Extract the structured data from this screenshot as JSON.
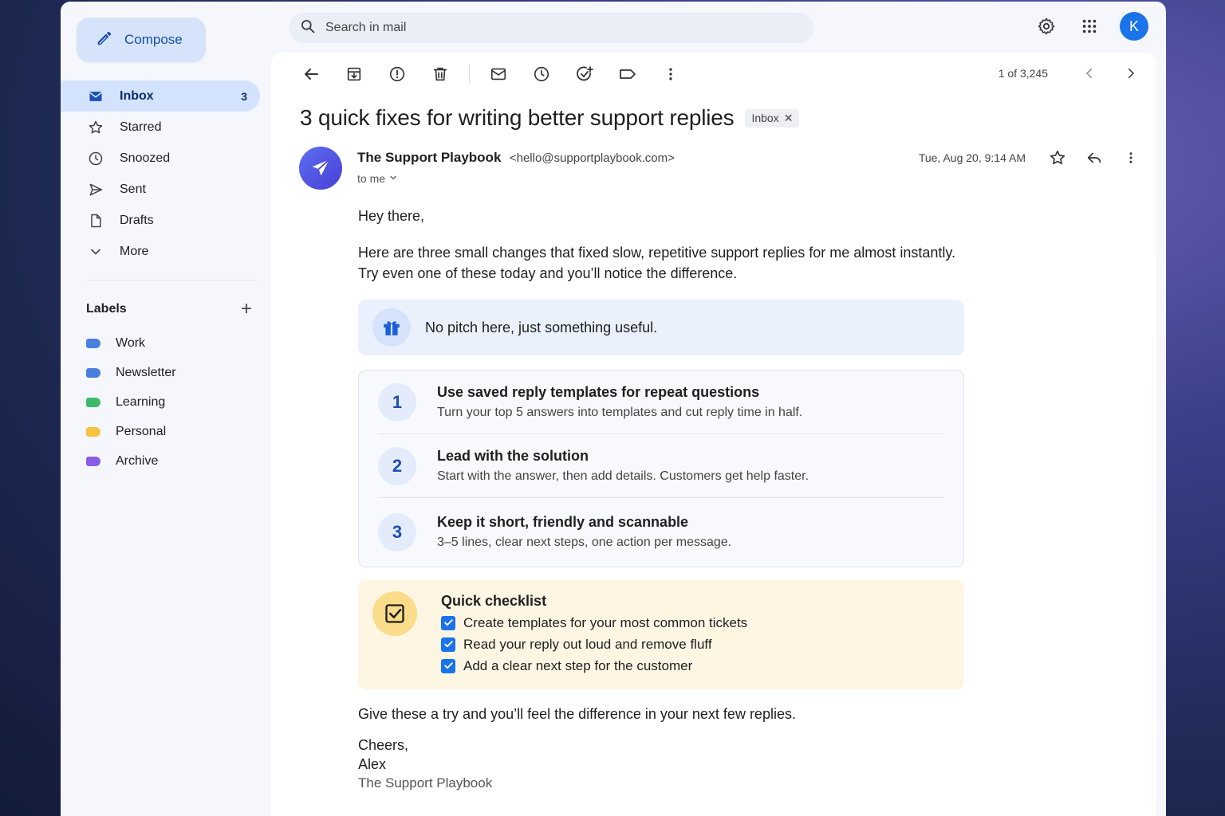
{
  "compose": {
    "label": "Compose"
  },
  "search": {
    "placeholder": "Search in mail"
  },
  "account": {
    "initial": "K"
  },
  "nav": {
    "items": [
      {
        "label": "Inbox",
        "count": "3",
        "icon": "inbox-icon"
      },
      {
        "label": "Starred",
        "icon": "star-icon"
      },
      {
        "label": "Snoozed",
        "icon": "clock-icon"
      },
      {
        "label": "Sent",
        "icon": "send-icon"
      },
      {
        "label": "Drafts",
        "icon": "draft-icon"
      },
      {
        "label": "More",
        "icon": "chevron-down-icon"
      }
    ]
  },
  "labels": {
    "title": "Labels",
    "items": [
      {
        "label": "Work",
        "color": "#4a7fe0"
      },
      {
        "label": "Newsletter",
        "color": "#4a7fe0"
      },
      {
        "label": "Learning",
        "color": "#3dbb6a"
      },
      {
        "label": "Personal",
        "color": "#f7c341"
      },
      {
        "label": "Archive",
        "color": "#8a5ce6"
      }
    ]
  },
  "pager": {
    "text": "1 of 3,245"
  },
  "email": {
    "subject": "3 quick fixes for writing better support replies",
    "chip": "Inbox",
    "sender_name": "The Support Playbook",
    "sender_email": "<hello@supportplaybook.com>",
    "to": "to me",
    "date": "Tue, Aug 20, 9:14 AM",
    "greeting": "Hey there,",
    "intro": "Here are three small changes that fixed slow, repetitive support replies for me almost instantly. Try even one of these today and you’ll notice the difference.",
    "note": "No pitch here, just something useful.",
    "tips": [
      {
        "num": "1",
        "title": "Use saved reply templates for repeat questions",
        "desc": "Turn your top 5 answers into templates and cut reply time in half."
      },
      {
        "num": "2",
        "title": "Lead with the solution",
        "desc": "Start with the answer, then add details. Customers get help faster."
      },
      {
        "num": "3",
        "title": "Keep it short, friendly and scannable",
        "desc": "3–5 lines, clear next steps, one action per message."
      }
    ],
    "checklist": {
      "title": "Quick checklist",
      "items": [
        "Create templates for your most common tickets",
        "Read your reply out loud and remove fluff",
        "Add a clear next step for the customer"
      ]
    },
    "outro": "Give these a try and you’ll feel the difference in your next few replies.",
    "signoff": "Cheers,",
    "signer": "Alex",
    "signer_org": "The Support Playbook"
  },
  "colors": {
    "accent": "#1a73e8",
    "nav_active_bg": "#d3e3fd",
    "compose_bg": "#d6e4fb"
  }
}
